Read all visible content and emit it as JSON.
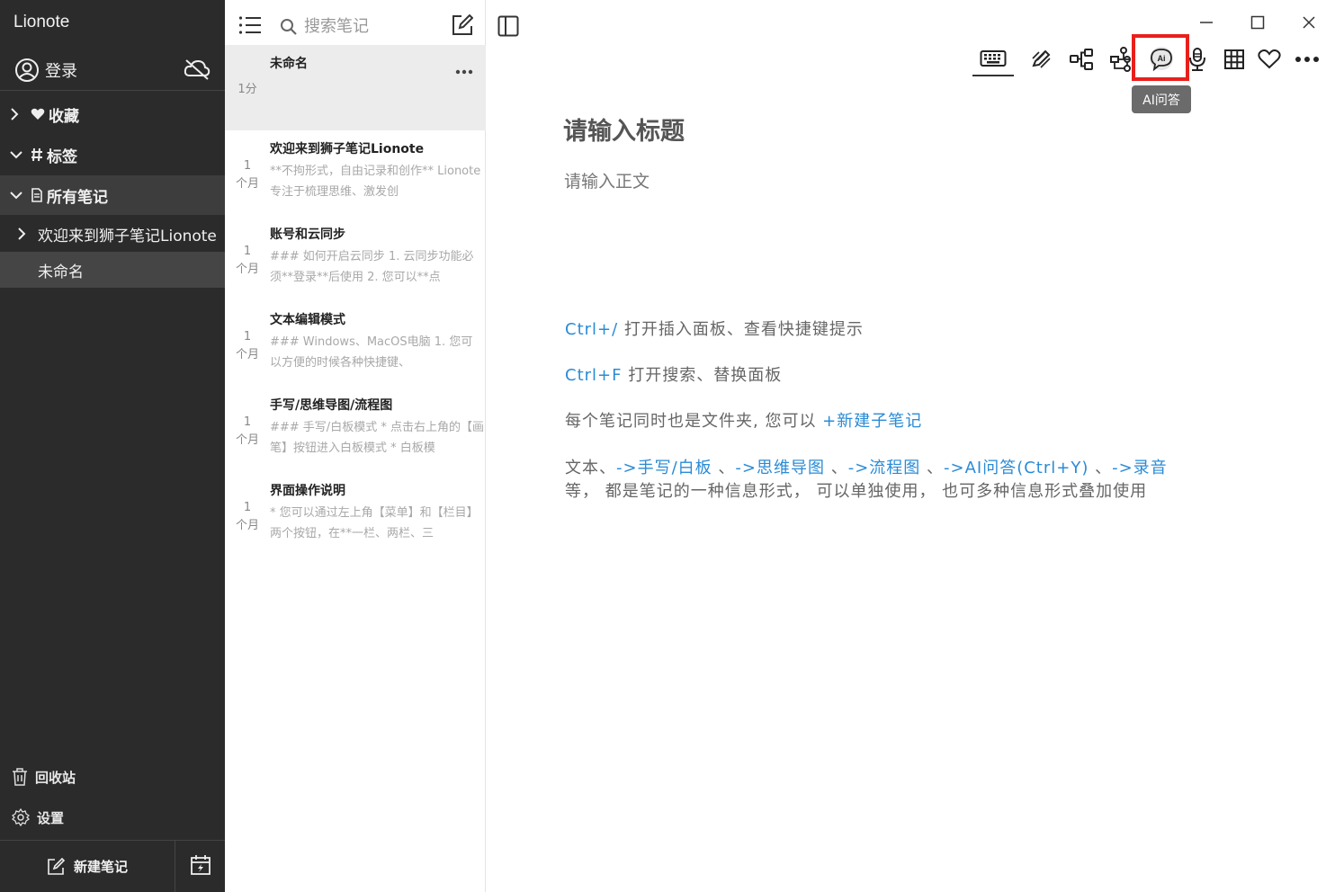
{
  "sidebar": {
    "app_title": "Lionote",
    "login_label": "登录",
    "favorites_label": "收藏",
    "tags_label": "标签",
    "all_notes_label": "所有笔记",
    "sub_items": [
      "欢迎来到狮子笔记Lionote",
      "未命名"
    ],
    "trash_label": "回收站",
    "settings_label": "设置",
    "new_note_label": "新建笔记"
  },
  "notelist": {
    "search_placeholder": "搜索笔记",
    "notes": [
      {
        "title": "未命名",
        "time": "1分",
        "snippet": ""
      },
      {
        "title": "欢迎来到狮子笔记Lionote",
        "time_top": "1",
        "time_bottom": "个月",
        "snippet": "**不拘形式，自由记录和创作** Lionote专注于梳理思维、激发创"
      },
      {
        "title": "账号和云同步",
        "time_top": "1",
        "time_bottom": "个月",
        "snippet": "### 如何开启云同步  1. 云同步功能必须**登录**后使用  2. 您可以**点"
      },
      {
        "title": "文本编辑模式",
        "time_top": "1",
        "time_bottom": "个月",
        "snippet": "### Windows、MacOS电脑  1. 您可以方便的时候各种快捷键、"
      },
      {
        "title": "手写/思维导图/流程图",
        "time_top": "1",
        "time_bottom": "个月",
        "snippet": "### 手写/白板模式  * 点击右上角的【画笔】按钮进入白板模式  * 白板模"
      },
      {
        "title": "界面操作说明",
        "time_top": "1",
        "time_bottom": "个月",
        "snippet": "* 您可以通过左上角【菜单】和【栏目】两个按钮，在**一栏、两栏、三"
      }
    ]
  },
  "editor": {
    "tooltip": "AI问答",
    "title_placeholder": "请输入标题",
    "body_placeholder": "请输入正文",
    "hint1_key": "Ctrl+/",
    "hint1_text": " 打开插入面板、查看快捷键提示",
    "hint2_key": "Ctrl+F",
    "hint2_text": " 打开搜索、替换面板",
    "hint3_text": "每个笔记同时也是文件夹, 您可以 ",
    "hint3_link": "+新建子笔记",
    "hint4_prefix": "文本、",
    "hint4_link1": "->手写/白板",
    "hint4_sep1": " 、",
    "hint4_link2": "->思维导图",
    "hint4_sep2": " 、",
    "hint4_link3": "->流程图",
    "hint4_sep3": " 、",
    "hint4_link4": "->AI问答(Ctrl+Y)",
    "hint4_sep4": " 、",
    "hint4_link5": "->录音",
    "hint5_text": "等， 都是笔记的一种信息形式， 可以单独使用， 也可多种信息形式叠加使用"
  },
  "colors": {
    "sidebar_bg": "#2b2b2b",
    "accent_blue": "#2a8bd6",
    "highlight_red": "#e8201c"
  }
}
